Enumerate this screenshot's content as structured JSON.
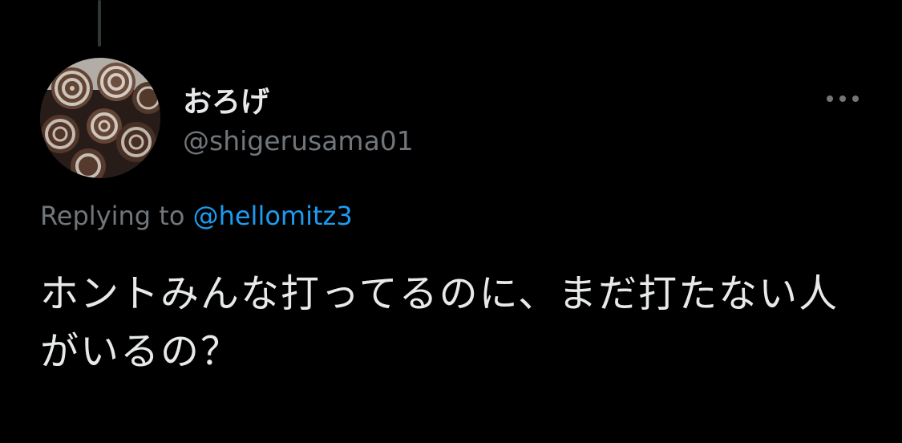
{
  "tweet": {
    "display_name": "おろげ",
    "handle": "@shigerusama01",
    "replying_prefix": "Replying to",
    "replying_to": "@hellomitz3",
    "text": "ホントみんな打ってるのに、まだ打たない人がいるの？"
  },
  "icons": {
    "more": "more-horizontal-icon",
    "avatar": "profile-avatar"
  },
  "colors": {
    "background": "#000000",
    "primary_text": "#e7e9ea",
    "secondary_text": "#71767b",
    "link": "#1d9bf0",
    "thread_line": "#333639"
  }
}
